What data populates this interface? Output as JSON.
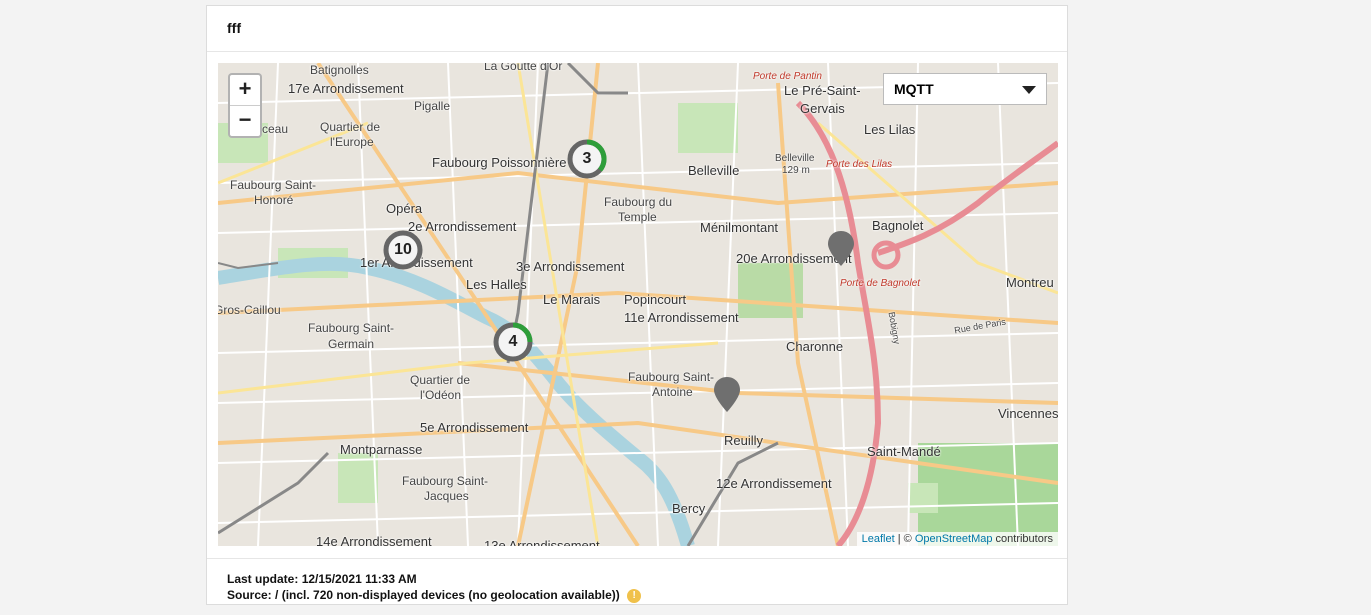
{
  "card": {
    "title": "fff"
  },
  "map": {
    "zoom_in": "+",
    "zoom_out": "−",
    "source_select": {
      "value": "MQTT"
    },
    "clusters": [
      {
        "count": "10"
      },
      {
        "count": "3"
      },
      {
        "count": "4"
      }
    ],
    "labels": {
      "batignolles": "Batignolles",
      "arr17": "17e Arrondissement",
      "goutte": "La Goutte d'Or",
      "pigalle": "Pigalle",
      "porte_pantin": "Porte de Pantin",
      "pre_st_gervais_1": "Le Pré-Saint-",
      "pre_st_gervais_2": "Gervais",
      "lilas": "Les Lilas",
      "quartier_europe_1": "Quartier de",
      "quartier_europe_2": "l'Europe",
      "ceau": "ceau",
      "fbg_poissonniere": "Faubourg Poissonnière",
      "porte_lilas": "Porte des Lilas",
      "fbg_st_honore_1": "Faubourg Saint-",
      "fbg_st_honore_2": "Honoré",
      "belleville": "Belleville",
      "belleville_alt_1": "Belleville",
      "belleville_alt_2": "129 m",
      "fbg_temple_1": "Faubourg du",
      "fbg_temple_2": "Temple",
      "opera": "Opéra",
      "arr2": "2e Arrondissement",
      "menilmontant": "Ménilmontant",
      "bagnolet": "Bagnolet",
      "arr1": "1er Arrondissement",
      "arr3": "3e Arrondissement",
      "arr20": "20e Arrondissement",
      "les_halles": "Les Halles",
      "porte_bagnolet": "Porte de Bagnolet",
      "montreuil": "Montreu",
      "gros_caillou": "Gros-Caillou",
      "le_marais": "Le Marais",
      "popincourt": "Popincourt",
      "arr11": "11e Arrondissement",
      "fbg_st_germain_1": "Faubourg Saint-",
      "fbg_st_germain_2": "Germain",
      "bobigny": "Bobigny",
      "rue_paris": "Rue de Paris",
      "charonne": "Charonne",
      "quartier_odeon_1": "Quartier de",
      "quartier_odeon_2": "l'Odéon",
      "fbg_st_antoine_1": "Faubourg Saint-",
      "fbg_st_antoine_2": "Antoine",
      "vincennes": "Vincennes",
      "arr5": "5e Arrondissement",
      "reuilly": "Reuilly",
      "montparnasse": "Montparnasse",
      "st_mande": "Saint-Mandé",
      "fbg_st_jacques_1": "Faubourg Saint-",
      "fbg_st_jacques_2": "Jacques",
      "arr12": "12e Arrondissement",
      "bercy": "Bercy",
      "arr14": "14e Arrondissement",
      "arr13": "13e Arrondissement"
    },
    "attribution": {
      "leaflet": "Leaflet",
      "sep": " | © ",
      "osm": "OpenStreetMap",
      "contributors": " contributors"
    }
  },
  "footer": {
    "last_update_label": "Last update:",
    "last_update_value": "12/15/2021 11:33 AM",
    "source_label": "Source:",
    "source_value": "/ (incl. 720 non-displayed devices (no geolocation available))",
    "warn_icon": "!"
  },
  "colors": {
    "cluster_ring": "#666666",
    "cluster_progress": "#2e9e3a",
    "pin": "#6f6f6f",
    "highway": "#e88c94",
    "water": "#aad3df"
  }
}
